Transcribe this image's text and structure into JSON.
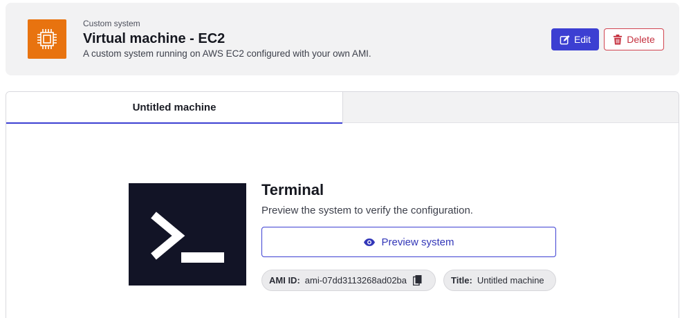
{
  "header": {
    "kicker": "Custom system",
    "title": "Virtual machine - EC2",
    "description": "A custom system running on AWS EC2 configured with your own AMI.",
    "edit_label": "Edit",
    "delete_label": "Delete",
    "icon": "ec2-chip-icon"
  },
  "tabs": [
    {
      "label": "Untitled machine",
      "active": true
    },
    {
      "label": "",
      "active": false
    }
  ],
  "main": {
    "icon": "terminal-icon",
    "title": "Terminal",
    "description": "Preview the system to verify the configuration.",
    "preview_label": "Preview system",
    "ami": {
      "key": "AMI ID:",
      "value": "ami-07dd3113268ad02ba"
    },
    "machine_title": {
      "key": "Title:",
      "value": "Untitled machine"
    }
  },
  "colors": {
    "accent": "#3c3fd2",
    "danger": "#d1434f",
    "aws_orange": "#e8730f",
    "terminal_bg": "#121426"
  }
}
